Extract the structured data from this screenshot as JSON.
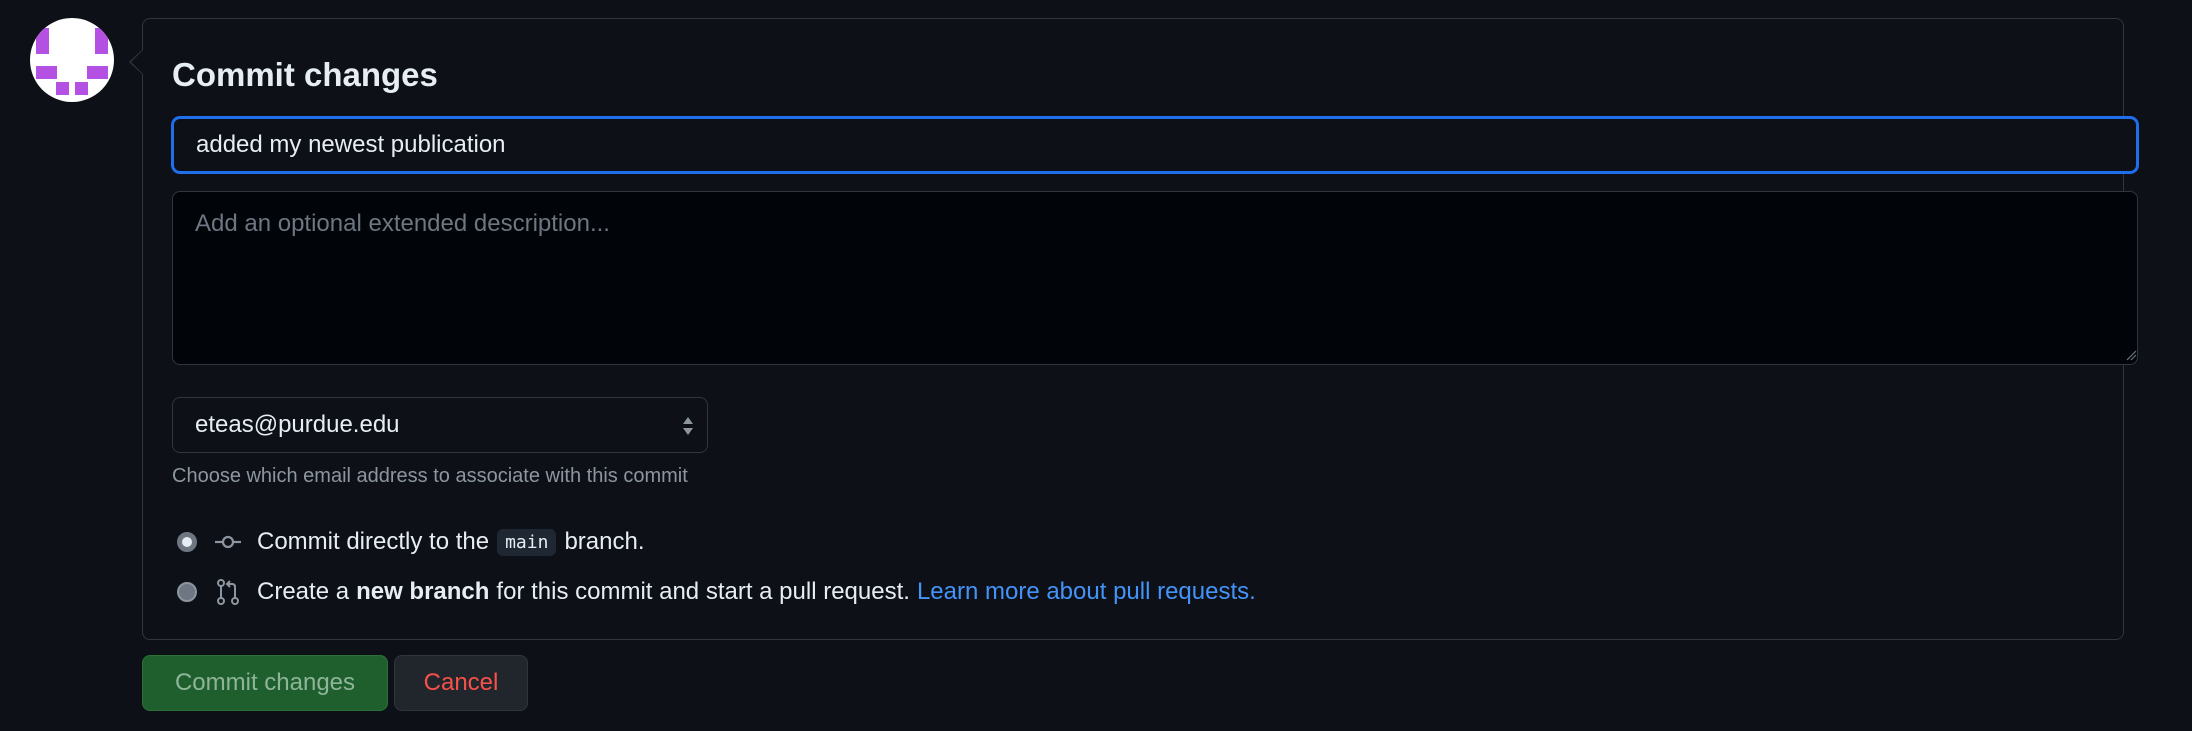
{
  "form": {
    "title": "Commit changes",
    "summary_value": "added my newest publication",
    "description_placeholder": "Add an optional extended description...",
    "email_selected": "eteas@purdue.edu",
    "email_hint": "Choose which email address to associate with this commit",
    "options": {
      "direct": {
        "text_before": "Commit directly to the",
        "branch": "main",
        "text_after": "branch.",
        "selected": true
      },
      "new_branch": {
        "text_before": "Create a",
        "bold": "new branch",
        "text_after": "for this commit and start a pull request.",
        "link": "Learn more about pull requests.",
        "selected": false
      }
    }
  },
  "actions": {
    "commit_label": "Commit changes",
    "cancel_label": "Cancel"
  },
  "colors": {
    "background": "#0d1117",
    "focus_ring": "#1f6feb",
    "link": "#4493f8",
    "commit_button": "#1f5f2e",
    "cancel_text": "#f85149",
    "avatar": "#b451e3"
  }
}
